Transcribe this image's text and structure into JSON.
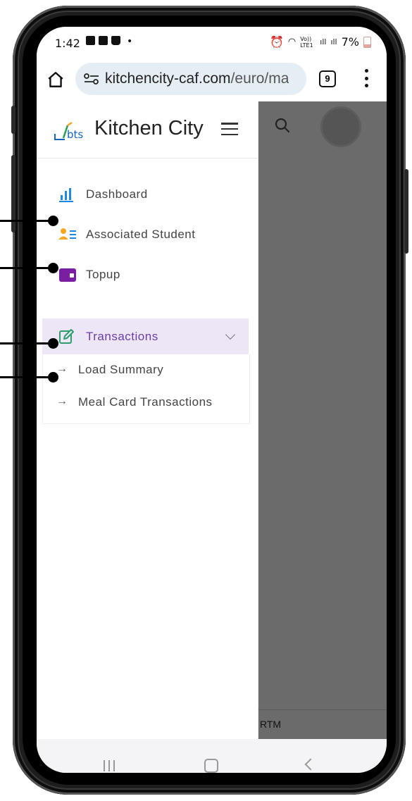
{
  "status_bar": {
    "time": "1:42",
    "dot": "•",
    "network": "Vo)) LTE1",
    "battery": "7%"
  },
  "browser": {
    "url_host": "kitchencity-caf.com",
    "url_path": "/euro/ma",
    "tab_count": "9"
  },
  "sidebar": {
    "brand": "Kitchen City",
    "logo_text": "bts",
    "items": [
      {
        "label": "Dashboard",
        "icon": "bar-chart-icon"
      },
      {
        "label": "Associated Student",
        "icon": "id-card-icon"
      },
      {
        "label": "Topup",
        "icon": "wallet-icon"
      },
      {
        "label": "Transactions",
        "icon": "edit-icon",
        "expanded": true
      }
    ],
    "submenu": [
      {
        "label": "Load Summary",
        "arrow": "→"
      },
      {
        "label": "Meal Card Transactions",
        "arrow": "→"
      }
    ]
  },
  "footer": {
    "text": "RTM"
  },
  "colors": {
    "active_bg": "#ede6f7",
    "active_text": "#6a3da8",
    "overlay": "#6b6b6b",
    "dashboard_icon": "#1e88e5",
    "student_icon": "#f5a623",
    "topup_icon": "#7b1fa2",
    "transactions_icon": "#2e9e6b"
  }
}
